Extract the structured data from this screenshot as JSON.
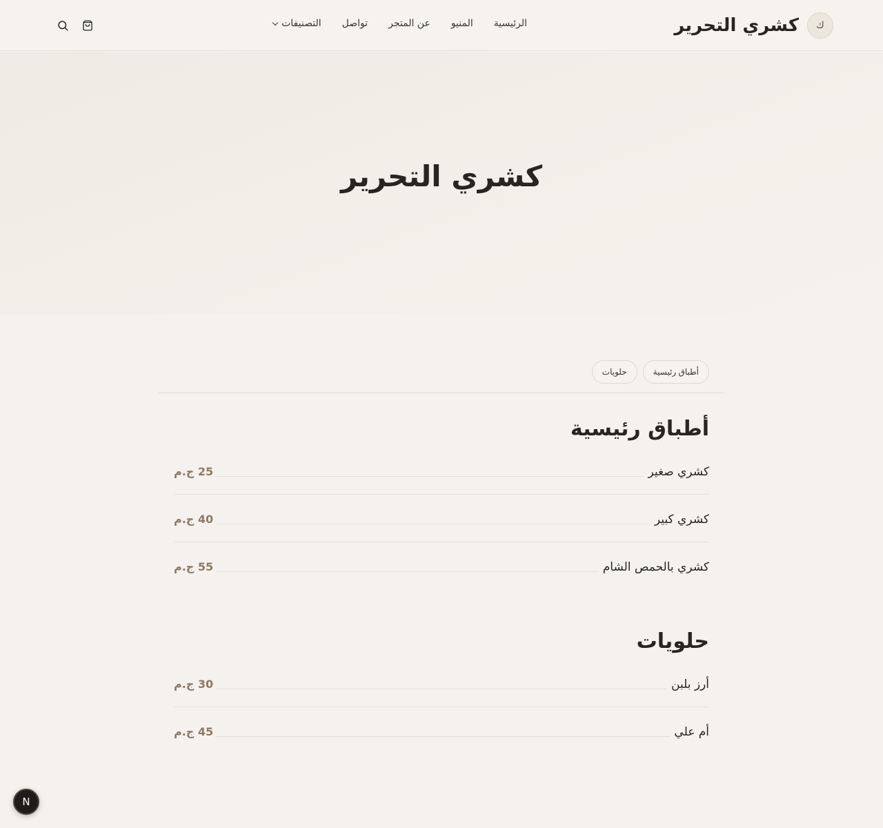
{
  "header": {
    "brand_initial": "ك",
    "brand_name": "كشري التحرير",
    "nav": [
      {
        "label": "الرئيسية"
      },
      {
        "label": "المنيو"
      },
      {
        "label": "عن المتجر"
      },
      {
        "label": "تواصل"
      },
      {
        "label": "التصنيفات"
      }
    ],
    "icons": [
      "search-icon",
      "cart-icon"
    ]
  },
  "hero": {
    "title": "كشري التحرير"
  },
  "tabs": [
    {
      "label": "أطباق رئيسية"
    },
    {
      "label": "حلويات"
    }
  ],
  "sections": [
    {
      "title": "أطباق رئيسية",
      "items": [
        {
          "name": "كشري صغير",
          "price": "25 ج.م"
        },
        {
          "name": "كشري كبير",
          "price": "40 ج.م"
        },
        {
          "name": "كشري بالحمص الشام",
          "price": "55 ج.م"
        }
      ]
    },
    {
      "title": "حلويات",
      "items": [
        {
          "name": "أرز بلبن",
          "price": "30 ج.م"
        },
        {
          "name": "أم علي",
          "price": "45 ج.م"
        }
      ]
    }
  ],
  "fab": {
    "label": "N"
  }
}
